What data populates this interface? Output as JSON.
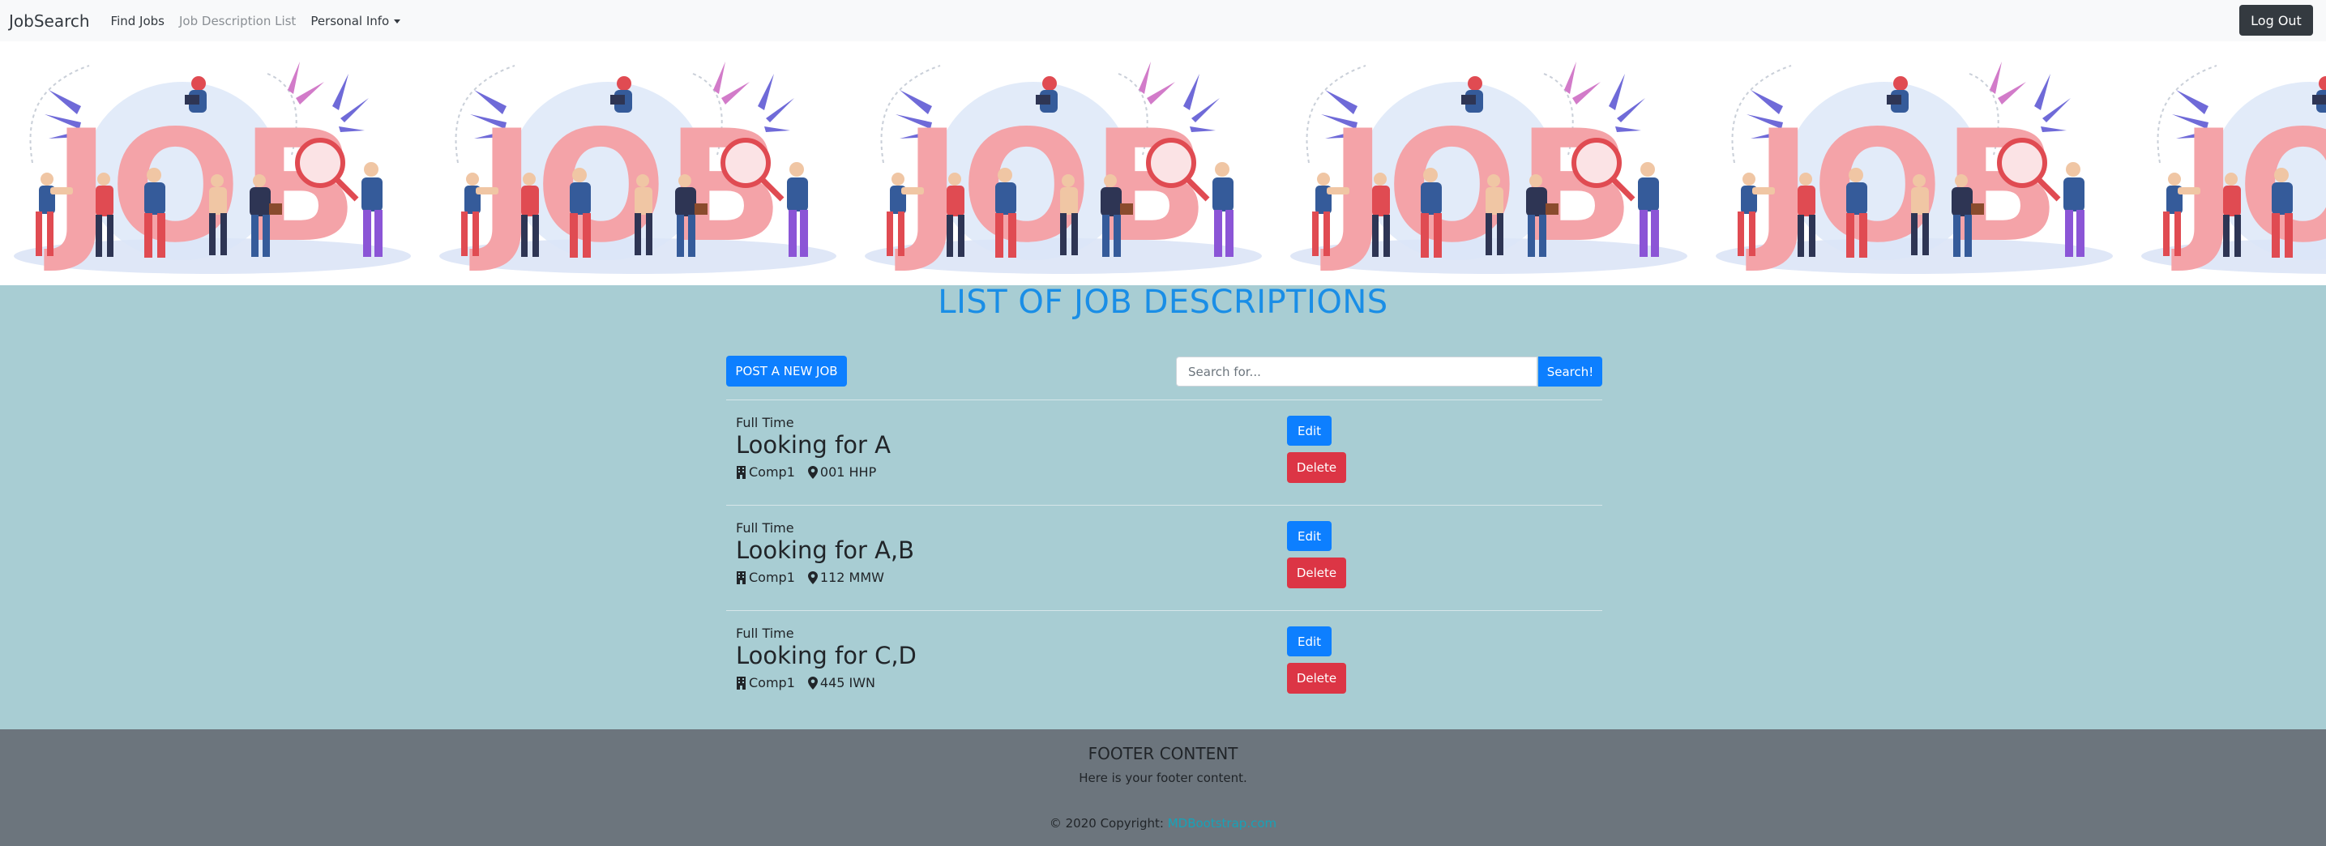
{
  "navbar": {
    "brand": "JobSearch",
    "links": [
      "Find Jobs",
      "Job Description List",
      "Personal Info"
    ],
    "logout_label": "Log Out"
  },
  "banner": {
    "word": "JOB",
    "colors": {
      "letters": "#f4a3a8",
      "blob": "#d9e4f7",
      "leaf_purple": "#6f6ad8",
      "leaf_pink": "#d27bc9"
    }
  },
  "main": {
    "title": "LIST OF JOB DESCRIPTIONS",
    "post_button": "POST A NEW JOB",
    "search": {
      "placeholder": "Search for...",
      "value": "",
      "button": "Search!"
    },
    "jobs": [
      {
        "type": "Full Time",
        "title": "Looking for A",
        "company": "Comp1",
        "location": "001 HHP",
        "edit": "Edit",
        "delete": "Delete"
      },
      {
        "type": "Full Time",
        "title": "Looking for A,B",
        "company": "Comp1",
        "location": "112 MMW",
        "edit": "Edit",
        "delete": "Delete"
      },
      {
        "type": "Full Time",
        "title": "Looking for C,D",
        "company": "Comp1",
        "location": "445 IWN",
        "edit": "Edit",
        "delete": "Delete"
      }
    ]
  },
  "footer": {
    "title": "FOOTER CONTENT",
    "subtitle": "Here is your footer content.",
    "copyright": "© 2020 Copyright:",
    "link": "MDBootstrap.com"
  },
  "colors": {
    "primary": "#0d7fff",
    "danger": "#dc3545",
    "page_bg": "#a8cdd3",
    "footer_bg": "#6c757d",
    "title": "#1a8ee6"
  }
}
